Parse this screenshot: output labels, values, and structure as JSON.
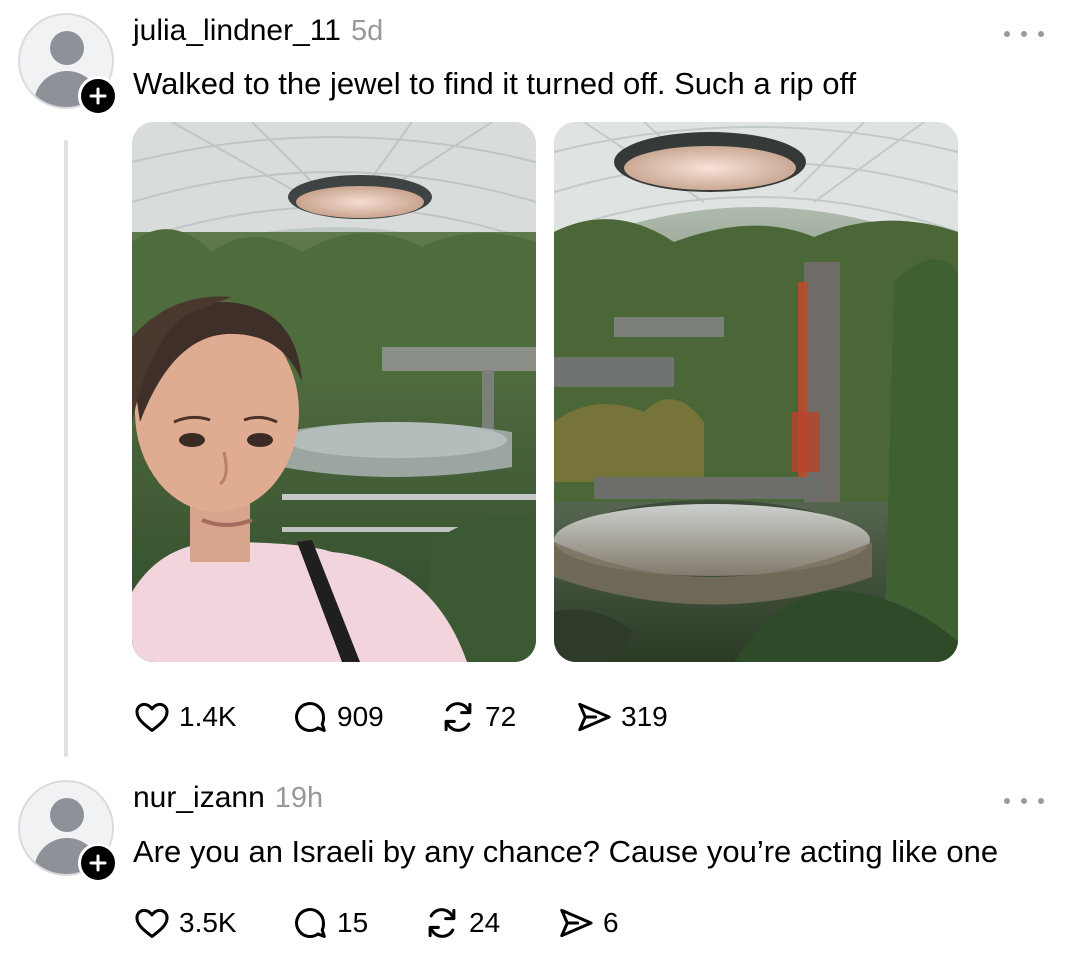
{
  "posts": [
    {
      "username": "julia_lindner_11",
      "time": "5d",
      "text": "Walked to the jewel to find it turned off. Such a rip off",
      "stats": {
        "likes": "1.4K",
        "replies": "909",
        "reposts": "72",
        "shares": "319"
      },
      "images": [
        "selfie photo at Jewel indoor garden",
        "Jewel indoor garden with waterfall turned off"
      ]
    },
    {
      "username": "nur_izann",
      "time": "19h",
      "text": "Are you an Israeli by any chance? Cause you’re acting like one",
      "stats": {
        "likes": "3.5K",
        "replies": "15",
        "reposts": "24",
        "shares": "6"
      }
    }
  ],
  "icons": {
    "avatar": "default-avatar-icon",
    "follow": "plus-icon",
    "more": "more-horizontal-icon",
    "like": "heart-icon",
    "reply": "comment-icon",
    "repost": "repost-icon",
    "share": "send-icon"
  },
  "colors": {
    "text": "#000000",
    "muted": "#999999",
    "thread_line": "#e1e1e1",
    "avatar_bg": "#f1f2f4"
  }
}
